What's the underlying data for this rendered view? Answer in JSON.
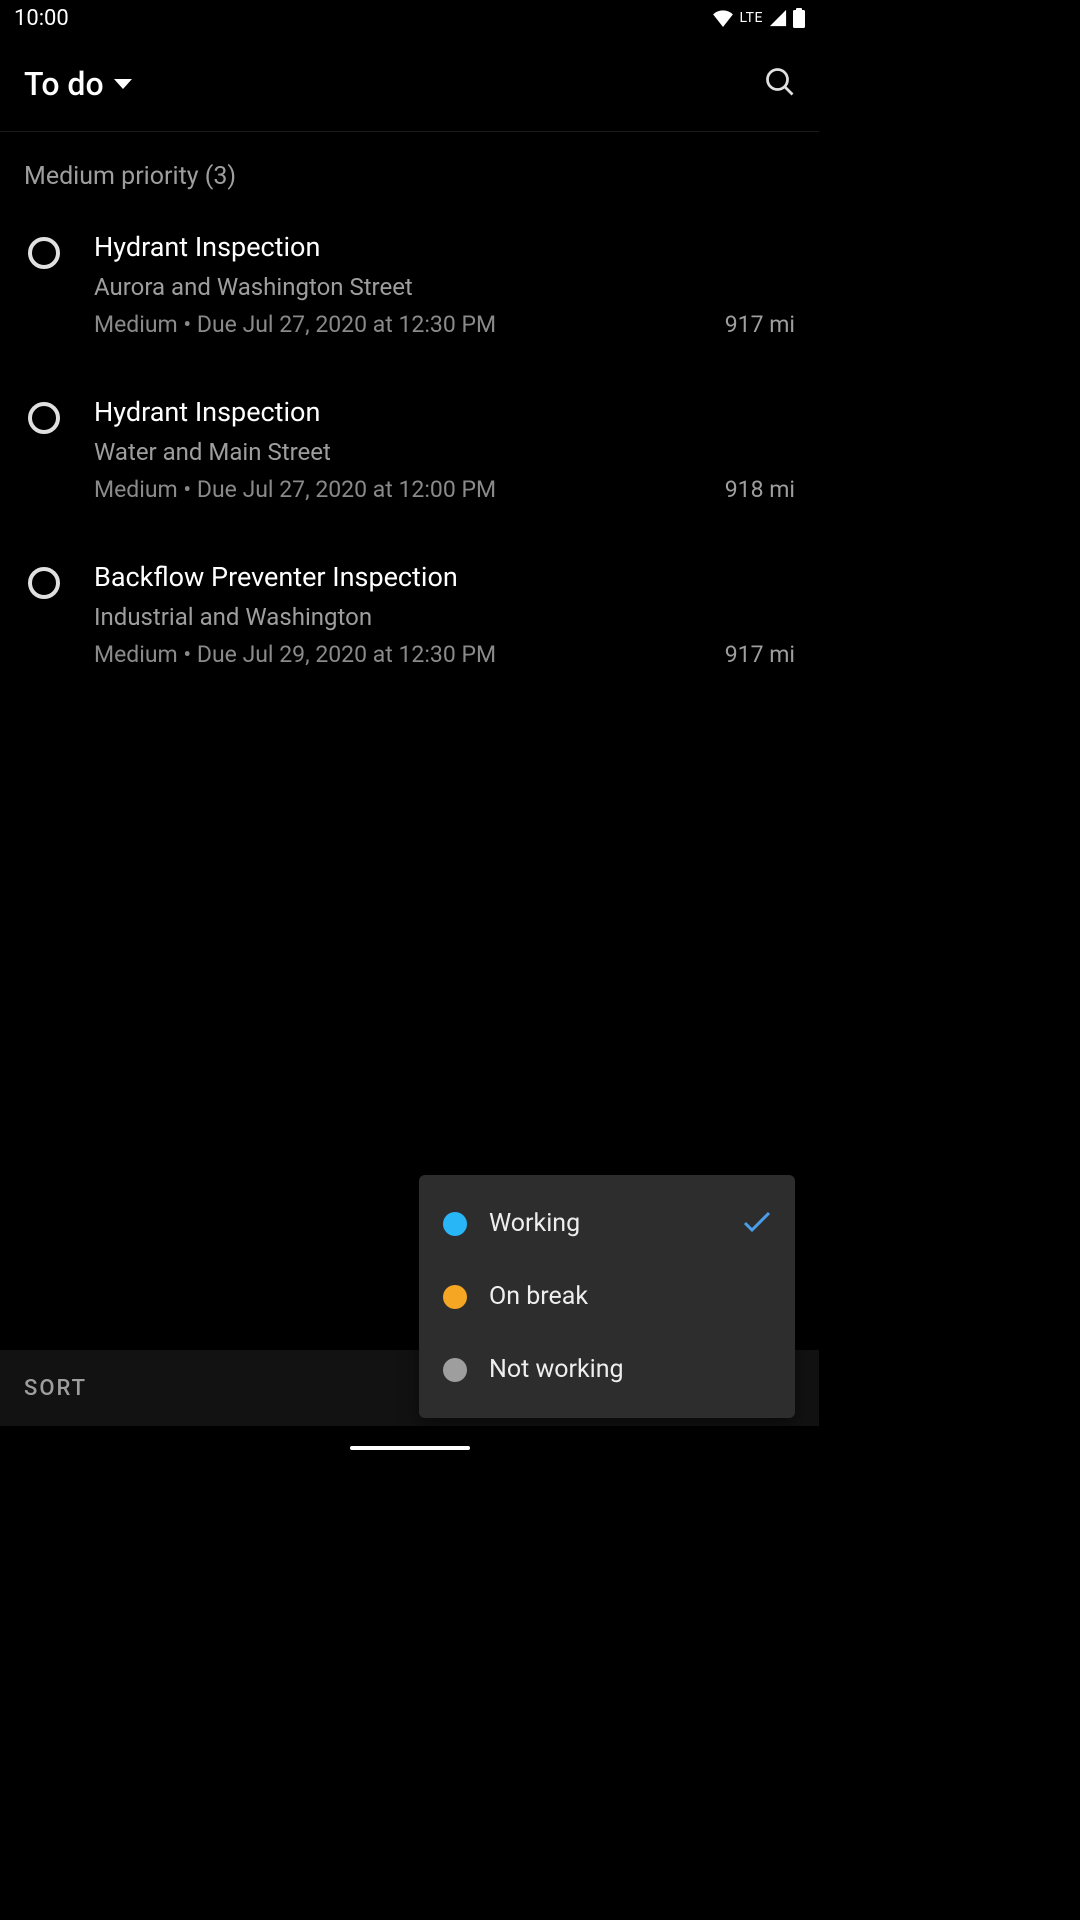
{
  "status_bar": {
    "time": "10:00",
    "network": "LTE"
  },
  "app_bar": {
    "title": "To do"
  },
  "section": {
    "header": "Medium priority (3)"
  },
  "tasks": [
    {
      "title": "Hydrant Inspection",
      "location": "Aurora and Washington Street",
      "priority": "Medium",
      "due": "Due Jul 27, 2020 at 12:30 PM",
      "distance": "917 mi"
    },
    {
      "title": "Hydrant Inspection",
      "location": "Water and Main Street",
      "priority": "Medium",
      "due": "Due Jul 27, 2020 at 12:00 PM",
      "distance": "918 mi"
    },
    {
      "title": "Backflow Preventer Inspection",
      "location": "Industrial and Washington",
      "priority": "Medium",
      "due": "Due Jul 29, 2020 at 12:30 PM",
      "distance": "917 mi"
    }
  ],
  "bottom_bar": {
    "sort": "SORT"
  },
  "status_menu": {
    "options": [
      {
        "label": "Working",
        "color": "#29b6f6",
        "selected": true
      },
      {
        "label": "On break",
        "color": "#f5a623",
        "selected": false
      },
      {
        "label": "Not working",
        "color": "#9e9e9e",
        "selected": false
      }
    ]
  }
}
